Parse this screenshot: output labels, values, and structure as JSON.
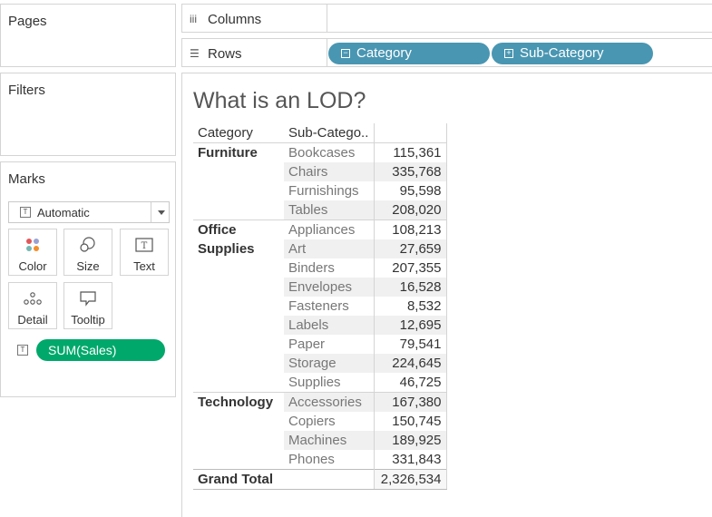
{
  "pages": {
    "title": "Pages"
  },
  "filters": {
    "title": "Filters"
  },
  "marks": {
    "title": "Marks",
    "mark_type": "Automatic",
    "buttons": {
      "color": "Color",
      "size": "Size",
      "text": "Text",
      "detail": "Detail",
      "tooltip": "Tooltip"
    },
    "pill": "SUM(Sales)",
    "pill_color": "#00a86b"
  },
  "shelves": {
    "columns_label": "Columns",
    "rows_label": "Rows",
    "rows_pills": [
      "Category",
      "Sub-Category"
    ],
    "pill_color": "#4996b2"
  },
  "view": {
    "title": "What is an LOD?",
    "headers": {
      "category": "Category",
      "subcategory": "Sub-Catego.."
    },
    "groups": [
      {
        "category": "Furniture",
        "rows": [
          {
            "sub": "Bookcases",
            "value": "115,361"
          },
          {
            "sub": "Chairs",
            "value": "335,768"
          },
          {
            "sub": "Furnishings",
            "value": "95,598"
          },
          {
            "sub": "Tables",
            "value": "208,020"
          }
        ]
      },
      {
        "category_line1": "Office",
        "category_line2": "Supplies",
        "rows": [
          {
            "sub": "Appliances",
            "value": "108,213"
          },
          {
            "sub": "Art",
            "value": "27,659"
          },
          {
            "sub": "Binders",
            "value": "207,355"
          },
          {
            "sub": "Envelopes",
            "value": "16,528"
          },
          {
            "sub": "Fasteners",
            "value": "8,532"
          },
          {
            "sub": "Labels",
            "value": "12,695"
          },
          {
            "sub": "Paper",
            "value": "79,541"
          },
          {
            "sub": "Storage",
            "value": "224,645"
          },
          {
            "sub": "Supplies",
            "value": "46,725"
          }
        ]
      },
      {
        "category": "Technology",
        "rows": [
          {
            "sub": "Accessories",
            "value": "167,380"
          },
          {
            "sub": "Copiers",
            "value": "150,745"
          },
          {
            "sub": "Machines",
            "value": "189,925"
          },
          {
            "sub": "Phones",
            "value": "331,843"
          }
        ]
      }
    ],
    "grand_total_label": "Grand Total",
    "grand_total_value": "2,326,534"
  }
}
